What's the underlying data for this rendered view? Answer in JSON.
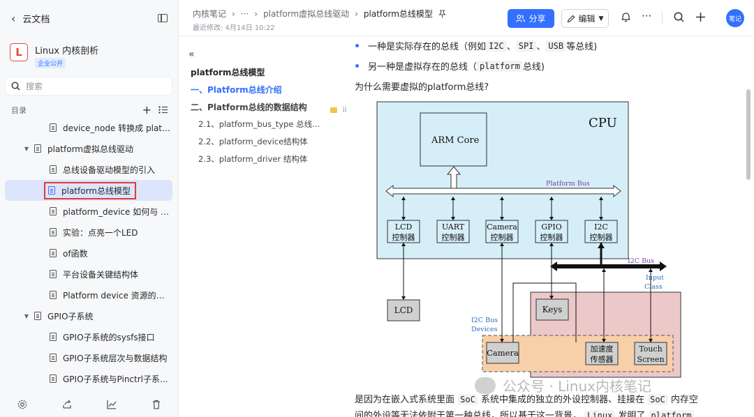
{
  "sidebar": {
    "back_label": "云文档",
    "kb_logo": "L",
    "kb_name": "Linux 内核剖析",
    "kb_badge": "企业公开",
    "search_placeholder": "搜索",
    "toc_label": "目录",
    "items": [
      {
        "label": "device_node 转换成 platfor...",
        "level": 2
      },
      {
        "label": "platform虚拟总线驱动",
        "level": 1
      },
      {
        "label": "总线设备驱动模型的引入",
        "level": 2
      },
      {
        "label": "platform总线模型",
        "level": 2,
        "active": true
      },
      {
        "label": "platform_device 如何与 pla...",
        "level": 2
      },
      {
        "label": "实验：点亮一个LED",
        "level": 2
      },
      {
        "label": "of函数",
        "level": 2
      },
      {
        "label": "平台设备关键结构体",
        "level": 2
      },
      {
        "label": "Platform device 资源的获取",
        "level": 2
      },
      {
        "label": "GPIO子系统",
        "level": 1
      },
      {
        "label": "GPIO子系统的sysfs接口",
        "level": 2
      },
      {
        "label": "GPIO子系统层次与数据结构",
        "level": 2
      },
      {
        "label": "GPIO子系统与Pinctrl子系...",
        "level": 2
      }
    ]
  },
  "header": {
    "crumb1": "内核笔记",
    "crumb_sep": "›",
    "crumb_more": "···",
    "crumb2": "platform虚拟总线驱动",
    "crumb3": "platform总线模型",
    "modified": "最近修改: 4月14日 10:22",
    "share": "分享",
    "edit": "编辑",
    "avatar": "笔记"
  },
  "outline": {
    "title": "platform总线模型",
    "items": [
      {
        "label": "一、Platform总线介绍",
        "type": "active"
      },
      {
        "label": "二、Platform总线的数据结构",
        "type": "h2"
      },
      {
        "label": "2.1、platform_bus_type 总线...",
        "type": "sub"
      },
      {
        "label": "2.2、platform_device结构体",
        "type": "sub"
      },
      {
        "label": "2.3、platform_driver 结构体",
        "type": "sub"
      }
    ]
  },
  "content": {
    "bullet1": {
      "pre": "一种是实际存在的总线（例如 ",
      "c1": "I2C",
      "sep1": " 、 ",
      "c2": "SPI",
      "sep2": " 、 ",
      "c3": "USB",
      "post": " 等总线)"
    },
    "bullet2": {
      "pre": "另一种是虚拟存在的总线（ ",
      "c1": "platform",
      "post": " 总线)"
    },
    "question": "为什么需要虚拟的platform总线?",
    "para1": {
      "pre": "是因为在嵌入式系统里面 ",
      "c1": "SoC",
      "mid": " 系统中集成的独立的外设控制器、挂接在 ",
      "c2": "SoC",
      "post": " 内存空"
    },
    "para2": {
      "pre": "间的外设等无法依附于第一种总线，所以基于这一背景， ",
      "c1": "Linux",
      "mid": " 发明了 ",
      "c2": "platform"
    }
  },
  "diagram": {
    "cpu": "CPU",
    "arm_core": "ARM Core",
    "platform_bus": "Platform Bus",
    "ctrl_suffix": "控制器",
    "controllers": [
      "LCD",
      "UART",
      "Camera",
      "GPIO",
      "I2C"
    ],
    "i2c_bus": "I2C Bus",
    "input_class_1": "Input",
    "input_class_2": "Class",
    "i2c_devices_1": "I2C Bus",
    "i2c_devices_2": "Devices",
    "lcd": "LCD",
    "keys": "Keys",
    "camera": "Camera",
    "accel_1": "加速度",
    "accel_2": "传感器",
    "touch_1": "Touch",
    "touch_2": "Screen"
  },
  "watermark": "公众号 · Linux内核笔记"
}
